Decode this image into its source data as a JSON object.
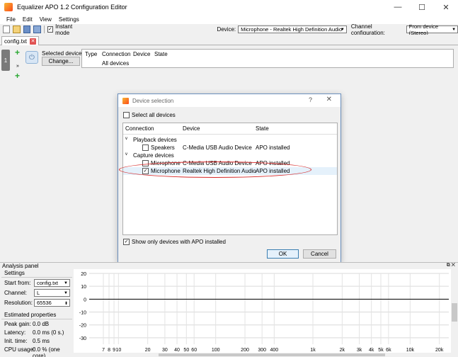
{
  "window": {
    "title": "Equalizer APO 1.2 Configuration Editor",
    "minimize": "—",
    "maximize": "☐",
    "close": "✕"
  },
  "menu": [
    "File",
    "Edit",
    "View",
    "Settings"
  ],
  "toolbar": {
    "instant_mode_label": "Instant mode",
    "instant_mode_checked": "✓",
    "device_label": "Device:",
    "device_value": "Microphone - Realtek High Definition Audio",
    "channel_label": "Channel configuration:",
    "channel_value": "From device (Stereo)"
  },
  "tab": {
    "label": "config.txt",
    "close": "✕"
  },
  "filter_row": {
    "number": "1",
    "selected_devices_label": "Selected devices:",
    "change_button": "Change...",
    "table_headers": [
      "Type",
      "Connection",
      "Device",
      "State"
    ],
    "table_value": "All devices"
  },
  "dialog": {
    "title": "Device selection",
    "help": "?",
    "close": "✕",
    "select_all_label": "Select all devices",
    "columns": [
      "Connection",
      "Device",
      "State"
    ],
    "groups": [
      {
        "label": "Playback devices",
        "arrow": "v",
        "items": [
          {
            "connection": "Speakers",
            "device": "C-Media USB Audio Device",
            "state": "APO installed",
            "checked": ""
          }
        ]
      },
      {
        "label": "Capture devices",
        "arrow": "v",
        "items": [
          {
            "connection": "Microphone",
            "device": "C-Media USB Audio Device",
            "state": "APO installed",
            "checked": ""
          },
          {
            "connection": "Microphone",
            "device": "Realtek High Definition Audio",
            "state": "APO installed",
            "checked": "✓"
          }
        ]
      }
    ],
    "show_only_label": "Show only devices with APO installed",
    "show_only_checked": "✓",
    "ok": "OK",
    "cancel": "Cancel"
  },
  "analysis": {
    "panel_title": "Analysis panel",
    "settings_title": "Settings",
    "start_from_label": "Start from:",
    "start_from_value": "config.txt",
    "channel_label": "Channel:",
    "channel_value": "L",
    "resolution_label": "Resolution:",
    "resolution_value": "65536",
    "estimated_title": "Estimated properties",
    "peak_gain_label": "Peak gain:",
    "peak_gain_value": "0.0 dB",
    "latency_label": "Latency:",
    "latency_value": "0.0 ms (0 s.)",
    "init_time_label": "Init. time:",
    "init_time_value": "0.5 ms",
    "cpu_usage_label": "CPU usage:",
    "cpu_usage_value": "0.0 % (one core)"
  },
  "chart_data": {
    "type": "line",
    "y_ticks": [
      "20",
      "10",
      "0",
      "-10",
      "-20",
      "-30"
    ],
    "ylim": [
      -35,
      20
    ],
    "x_ticks": [
      "7",
      "8",
      "9",
      "10",
      "20",
      "30",
      "40",
      "50",
      "60",
      "100",
      "200",
      "300",
      "400",
      "1k",
      "2k",
      "3k",
      "4k",
      "5k",
      "6k",
      "10k",
      "20k"
    ],
    "x_tick_values": [
      7,
      8,
      9,
      10,
      20,
      30,
      40,
      50,
      60,
      100,
      200,
      300,
      400,
      1000,
      2000,
      3000,
      4000,
      5000,
      6000,
      10000,
      20000
    ],
    "xlim": [
      5,
      25000
    ],
    "x_scale": "log",
    "series": [
      {
        "x": [
          5,
          25000
        ],
        "y": [
          0,
          0
        ]
      }
    ],
    "grid": true
  }
}
